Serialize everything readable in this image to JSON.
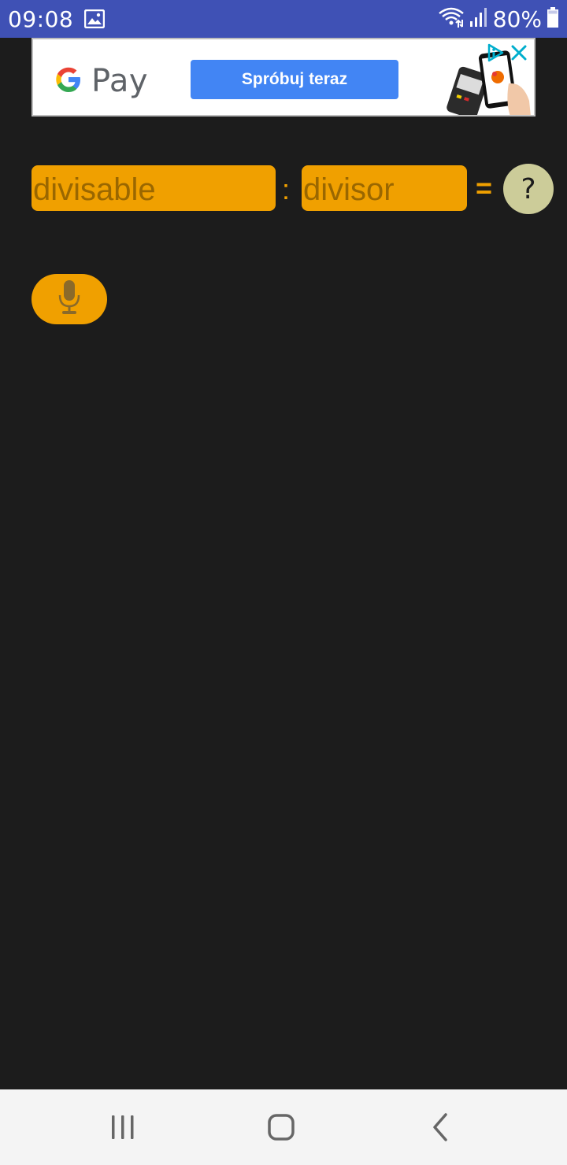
{
  "status_bar": {
    "time": "09:08",
    "battery": "80%",
    "icons": [
      "image-icon",
      "wifi-icon",
      "signal-icon",
      "battery-icon"
    ]
  },
  "ad": {
    "brand": "Pay",
    "cta": "Spróbuj teraz",
    "colors": {
      "cta_bg": "#4285f4",
      "ad_choices": "#00aecd"
    }
  },
  "equation": {
    "divisable_placeholder": "divisable",
    "divisor_placeholder": "divisor",
    "operator": ":",
    "equals": "=",
    "help_label": "?"
  },
  "mic": {
    "icon": "microphone-icon"
  },
  "nav_bar": {
    "icons": [
      "recents-icon",
      "home-icon",
      "back-icon"
    ]
  },
  "colors": {
    "accent": "#f0a000",
    "background": "#1c1c1c",
    "status_bar": "#3f51b5",
    "help_button": "#cccc99"
  }
}
